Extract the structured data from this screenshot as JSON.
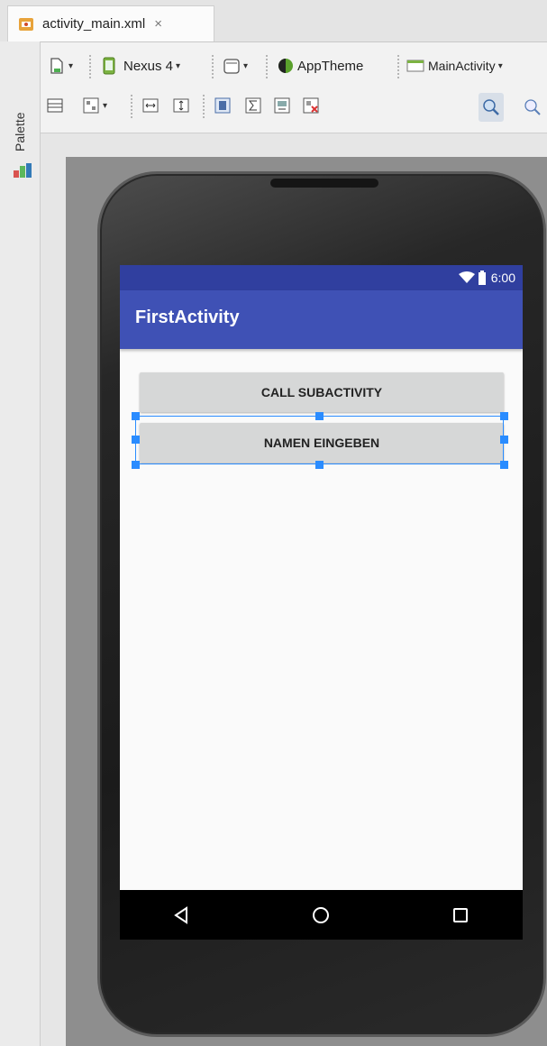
{
  "editor_tab": {
    "filename": "activity_main.xml",
    "close_symbol": "×",
    "icon": "xml-file-icon"
  },
  "palette": {
    "label": "Palette",
    "icon": "palette-icon"
  },
  "toolbar": {
    "device_label": "Nexus 4",
    "theme_label": "AppTheme",
    "activity_label": "MainActivity",
    "icons": [
      "new-layout-icon",
      "device-icon",
      "orientation-icon",
      "theme-icon",
      "activity-icon",
      "layout-icon",
      "preview-icon",
      "fit-width-icon",
      "fit-height-icon",
      "lint-icon",
      "sum-icon",
      "landscape-icon",
      "clear-icon",
      "zoom-in-icon",
      "zoom-actual-icon"
    ]
  },
  "device": {
    "status_time": "6:00",
    "app_title": "FirstActivity",
    "buttons": [
      {
        "label": "CALL SUBACTIVITY",
        "selected": false
      },
      {
        "label": "NAMEN EINGEBEN",
        "selected": true
      }
    ],
    "nav_icons": [
      "back-icon",
      "home-icon",
      "recents-icon"
    ]
  },
  "colors": {
    "status_bar": "#303f9f",
    "app_bar": "#3f51b5",
    "selection": "#2a8cff",
    "button_bg": "#d6d7d7"
  }
}
